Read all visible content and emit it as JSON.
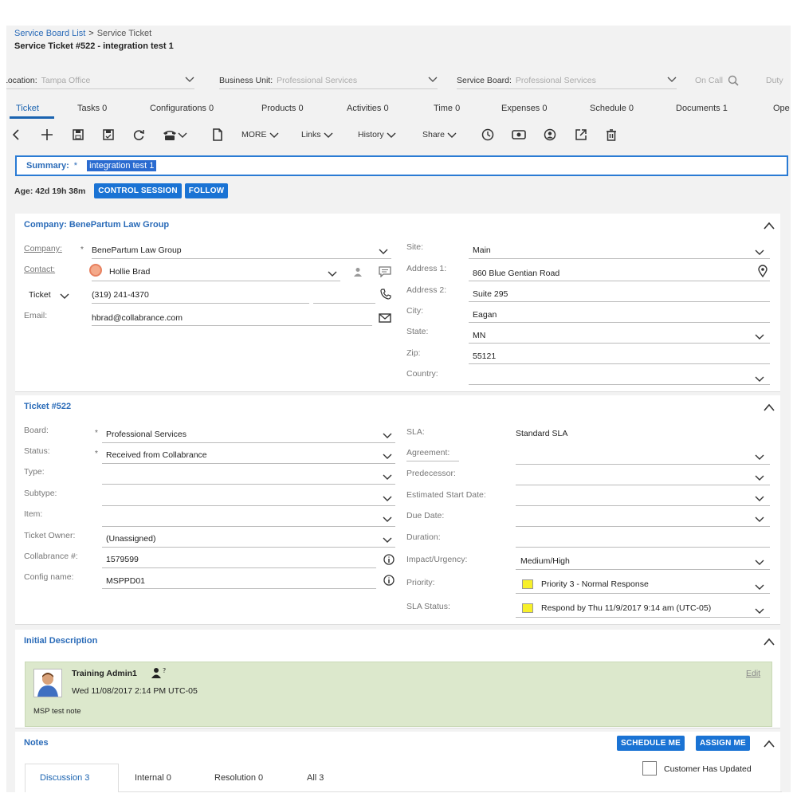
{
  "breadcrumb": {
    "link": "Service Board List",
    "separator": ">",
    "current": "Service Ticket"
  },
  "page_title": "Service Ticket #522 - integration test 1",
  "filters": {
    "location_label": "Location:",
    "location_value": "Tampa Office",
    "business_unit_label": "Business Unit:",
    "business_unit_value": "Professional Services",
    "service_board_label": "Service Board:",
    "service_board_value": "Professional Services",
    "on_call": "On Call",
    "duty": "Duty"
  },
  "tabs": [
    {
      "label": "Ticket"
    },
    {
      "label": "Tasks 0"
    },
    {
      "label": "Configurations 0"
    },
    {
      "label": "Products 0"
    },
    {
      "label": "Activities 0"
    },
    {
      "label": "Time 0"
    },
    {
      "label": "Expenses 0"
    },
    {
      "label": "Schedule 0"
    },
    {
      "label": "Documents 1"
    },
    {
      "label": "Ope"
    }
  ],
  "toolbar": {
    "more": "MORE",
    "links": "Links",
    "history": "History",
    "share": "Share"
  },
  "summary": {
    "label": "Summary:",
    "required": "*",
    "value": "integration test 1"
  },
  "age": {
    "text": "Age: 42d 19h 38m",
    "control_session": "CONTROL SESSION",
    "follow": "FOLLOW"
  },
  "company_panel": {
    "title": "Company: BenePartum Law Group",
    "company_label": "Company:",
    "company_value": "BenePartum Law Group",
    "contact_label": "Contact:",
    "contact_value": "Hollie Brad",
    "phone_type": "Ticket",
    "phone_value": "(319) 241-4370",
    "email_label": "Email:",
    "email_value": "hbrad@collabrance.com",
    "site_label": "Site:",
    "site_value": "Main",
    "address1_label": "Address 1:",
    "address1_value": "860 Blue Gentian Road",
    "address2_label": "Address 2:",
    "address2_value": "Suite 295",
    "city_label": "City:",
    "city_value": "Eagan",
    "state_label": "State:",
    "state_value": "MN",
    "zip_label": "Zip:",
    "zip_value": "55121",
    "country_label": "Country:",
    "country_value": ""
  },
  "ticket_panel": {
    "title": "Ticket #522",
    "board_label": "Board:",
    "board_value": "Professional Services",
    "status_label": "Status:",
    "status_value": "Received from Collabrance",
    "type_label": "Type:",
    "subtype_label": "Subtype:",
    "item_label": "Item:",
    "owner_label": "Ticket Owner:",
    "owner_value": "(Unassigned)",
    "collabrance_label": "Collabrance #:",
    "collabrance_value": "1579599",
    "config_label": "Config name:",
    "config_value": "MSPPD01",
    "sla_label": "SLA:",
    "sla_value": "Standard SLA",
    "agreement_label": "Agreement:",
    "predecessor_label": "Predecessor:",
    "est_start_label": "Estimated Start Date:",
    "due_label": "Due Date:",
    "duration_label": "Duration:",
    "impact_label": "Impact/Urgency:",
    "impact_value": "Medium/High",
    "priority_label": "Priority:",
    "priority_value": "Priority 3 - Normal Response",
    "sla_status_label": "SLA Status:",
    "sla_status_value": "Respond by Thu 11/9/2017 9:14 am (UTC-05)",
    "priority_color": "#f7f02a"
  },
  "description_panel": {
    "title": "Initial Description",
    "author": "Training Admin1",
    "timestamp": "Wed 11/08/2017 2:14 PM UTC-05",
    "body": "MSP test note",
    "edit": "Edit"
  },
  "notes_panel": {
    "title": "Notes",
    "schedule_me": "SCHEDULE ME",
    "assign_me": "ASSIGN ME",
    "tabs": [
      {
        "label": "Discussion 3"
      },
      {
        "label": "Internal 0"
      },
      {
        "label": "Resolution 0"
      },
      {
        "label": "All 3"
      }
    ],
    "customer_updated": "Customer Has Updated"
  },
  "colors": {
    "accent": "#1a73d4",
    "link": "#2a6bb8",
    "description_bg": "#dce8cc"
  }
}
